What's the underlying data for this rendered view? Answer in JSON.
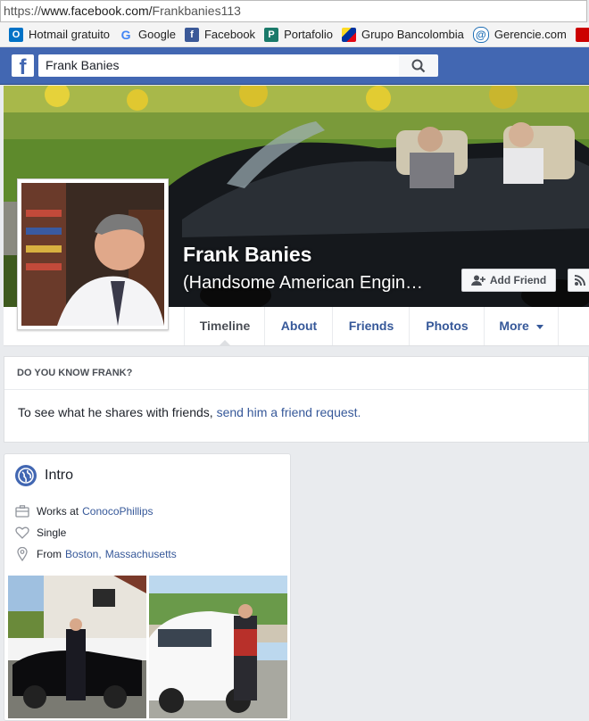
{
  "browser": {
    "url_scheme": "https://",
    "url_rest": "www.facebook.com/",
    "url_path": "Frankbanies113"
  },
  "bookmarks": [
    {
      "label": "Hotmail gratuito",
      "icon": "outlook-icon",
      "color": "#0072c6"
    },
    {
      "label": "Google",
      "icon": "google-icon",
      "color": "#4285f4"
    },
    {
      "label": "Facebook",
      "icon": "facebook-icon",
      "color": "#3b5998"
    },
    {
      "label": "Portafolio",
      "icon": "portafolio-icon",
      "color": "#1a7a6a"
    },
    {
      "label": "Grupo Bancolombia",
      "icon": "bancolombia-icon",
      "color": "#fdda24"
    },
    {
      "label": "Gerencie.com",
      "icon": "gerencie-icon",
      "color": "#1f6fb5"
    }
  ],
  "facebook": {
    "logo": "f",
    "search_value": "Frank Banies",
    "brand_color": "#4267b2"
  },
  "profile": {
    "name": "Frank Banies",
    "alternate_name": "(Handsome American Engin…",
    "add_friend_label": "Add Friend"
  },
  "tabs": [
    {
      "label": "Timeline",
      "active": true
    },
    {
      "label": "About"
    },
    {
      "label": "Friends"
    },
    {
      "label": "Photos"
    },
    {
      "label": "More",
      "dropdown": true
    }
  ],
  "do_you_know": {
    "heading": "DO YOU KNOW FRANK?",
    "text": "To see what he shares with friends, ",
    "link": "send him a friend request."
  },
  "intro": {
    "title": "Intro",
    "work_prefix": "Works at",
    "work_link": "ConocoPhillips",
    "relationship": "Single",
    "from_prefix": "From",
    "from_city": "Boston,",
    "from_state": "Massachusetts"
  }
}
